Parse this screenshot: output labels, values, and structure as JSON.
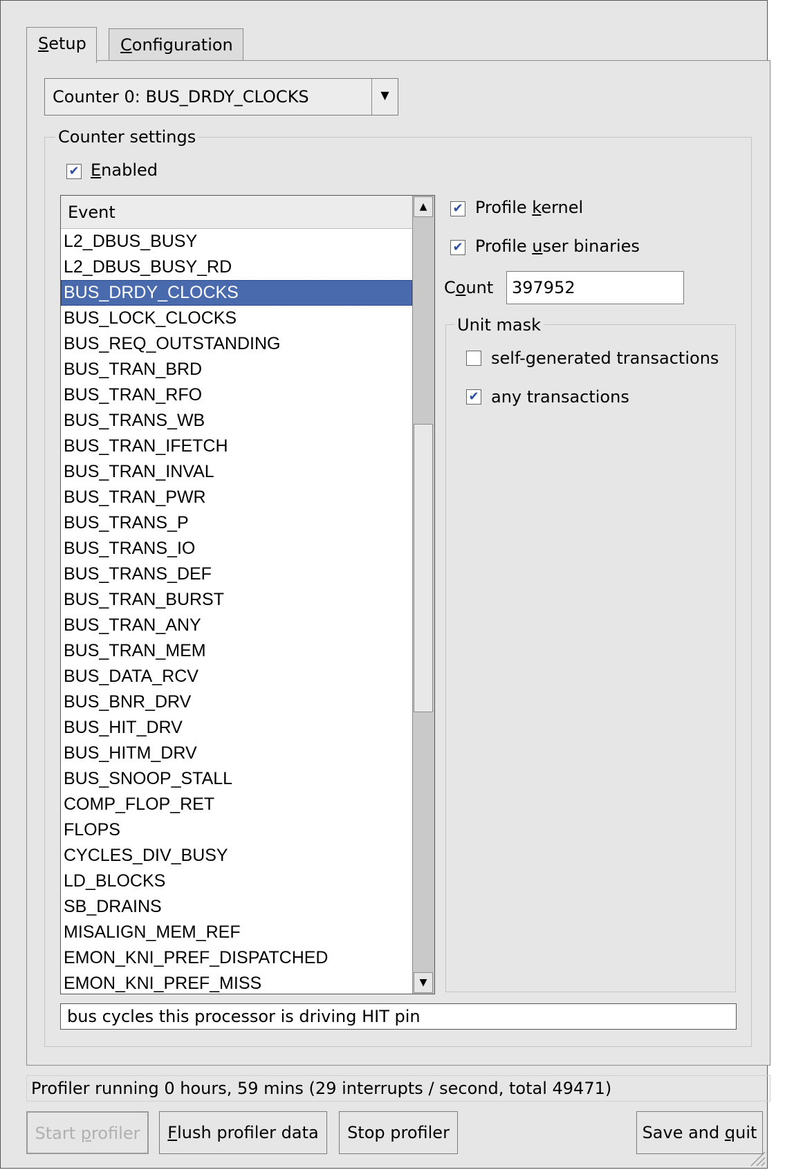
{
  "tabs": [
    {
      "label": "Setup",
      "mnemonic": "S",
      "rest": "etup",
      "active": true
    },
    {
      "label": "Configuration",
      "mnemonic": "C",
      "rest": "onfiguration",
      "active": false
    }
  ],
  "counter_select": {
    "value": "Counter 0: BUS_DRDY_CLOCKS"
  },
  "counter_settings": {
    "title": "Counter settings",
    "enabled": {
      "label": "Enabled",
      "mnemonic": "E",
      "rest": "nabled",
      "checked": true
    }
  },
  "event_list": {
    "header": "Event",
    "selected": "BUS_DRDY_CLOCKS",
    "items": [
      "L2_DBUS_BUSY",
      "L2_DBUS_BUSY_RD",
      "BUS_DRDY_CLOCKS",
      "BUS_LOCK_CLOCKS",
      "BUS_REQ_OUTSTANDING",
      "BUS_TRAN_BRD",
      "BUS_TRAN_RFO",
      "BUS_TRANS_WB",
      "BUS_TRAN_IFETCH",
      "BUS_TRAN_INVAL",
      "BUS_TRAN_PWR",
      "BUS_TRANS_P",
      "BUS_TRANS_IO",
      "BUS_TRANS_DEF",
      "BUS_TRAN_BURST",
      "BUS_TRAN_ANY",
      "BUS_TRAN_MEM",
      "BUS_DATA_RCV",
      "BUS_BNR_DRV",
      "BUS_HIT_DRV",
      "BUS_HITM_DRV",
      "BUS_SNOOP_STALL",
      "COMP_FLOP_RET",
      "FLOPS",
      "CYCLES_DIV_BUSY",
      "LD_BLOCKS",
      "SB_DRAINS",
      "MISALIGN_MEM_REF",
      "EMON_KNI_PREF_DISPATCHED",
      "EMON_KNI_PREF_MISS"
    ]
  },
  "options": {
    "profile_kernel": {
      "pre": "Profile ",
      "mnemonic": "k",
      "rest": "ernel",
      "checked": true
    },
    "profile_user": {
      "pre": "Profile ",
      "mnemonic": "u",
      "rest": "ser binaries",
      "checked": true
    },
    "count": {
      "pre": "C",
      "mnemonic": "o",
      "rest": "unt",
      "value": "397952"
    }
  },
  "unit_mask": {
    "title": "Unit mask",
    "items": [
      {
        "label": "self-generated transactions",
        "checked": false
      },
      {
        "label": "any transactions",
        "checked": true
      }
    ]
  },
  "event_description": "bus cycles this processor is driving HIT pin",
  "status_text": "Profiler running 0 hours, 59 mins (29 interrupts / second, total 49471)",
  "buttons": {
    "start": {
      "pre": "Start ",
      "mnemonic": "p",
      "rest": "rofiler",
      "enabled": false
    },
    "flush": {
      "pre": "",
      "mnemonic": "F",
      "rest": "lush profiler data",
      "enabled": true
    },
    "stop": {
      "label": "Stop profiler",
      "enabled": true
    },
    "save": {
      "pre": "Save and ",
      "mnemonic": "q",
      "rest": "uit",
      "enabled": true
    }
  },
  "colors": {
    "selection": "#4a6aae",
    "check": "#2b4fa0",
    "window": "#e6e6e6"
  }
}
